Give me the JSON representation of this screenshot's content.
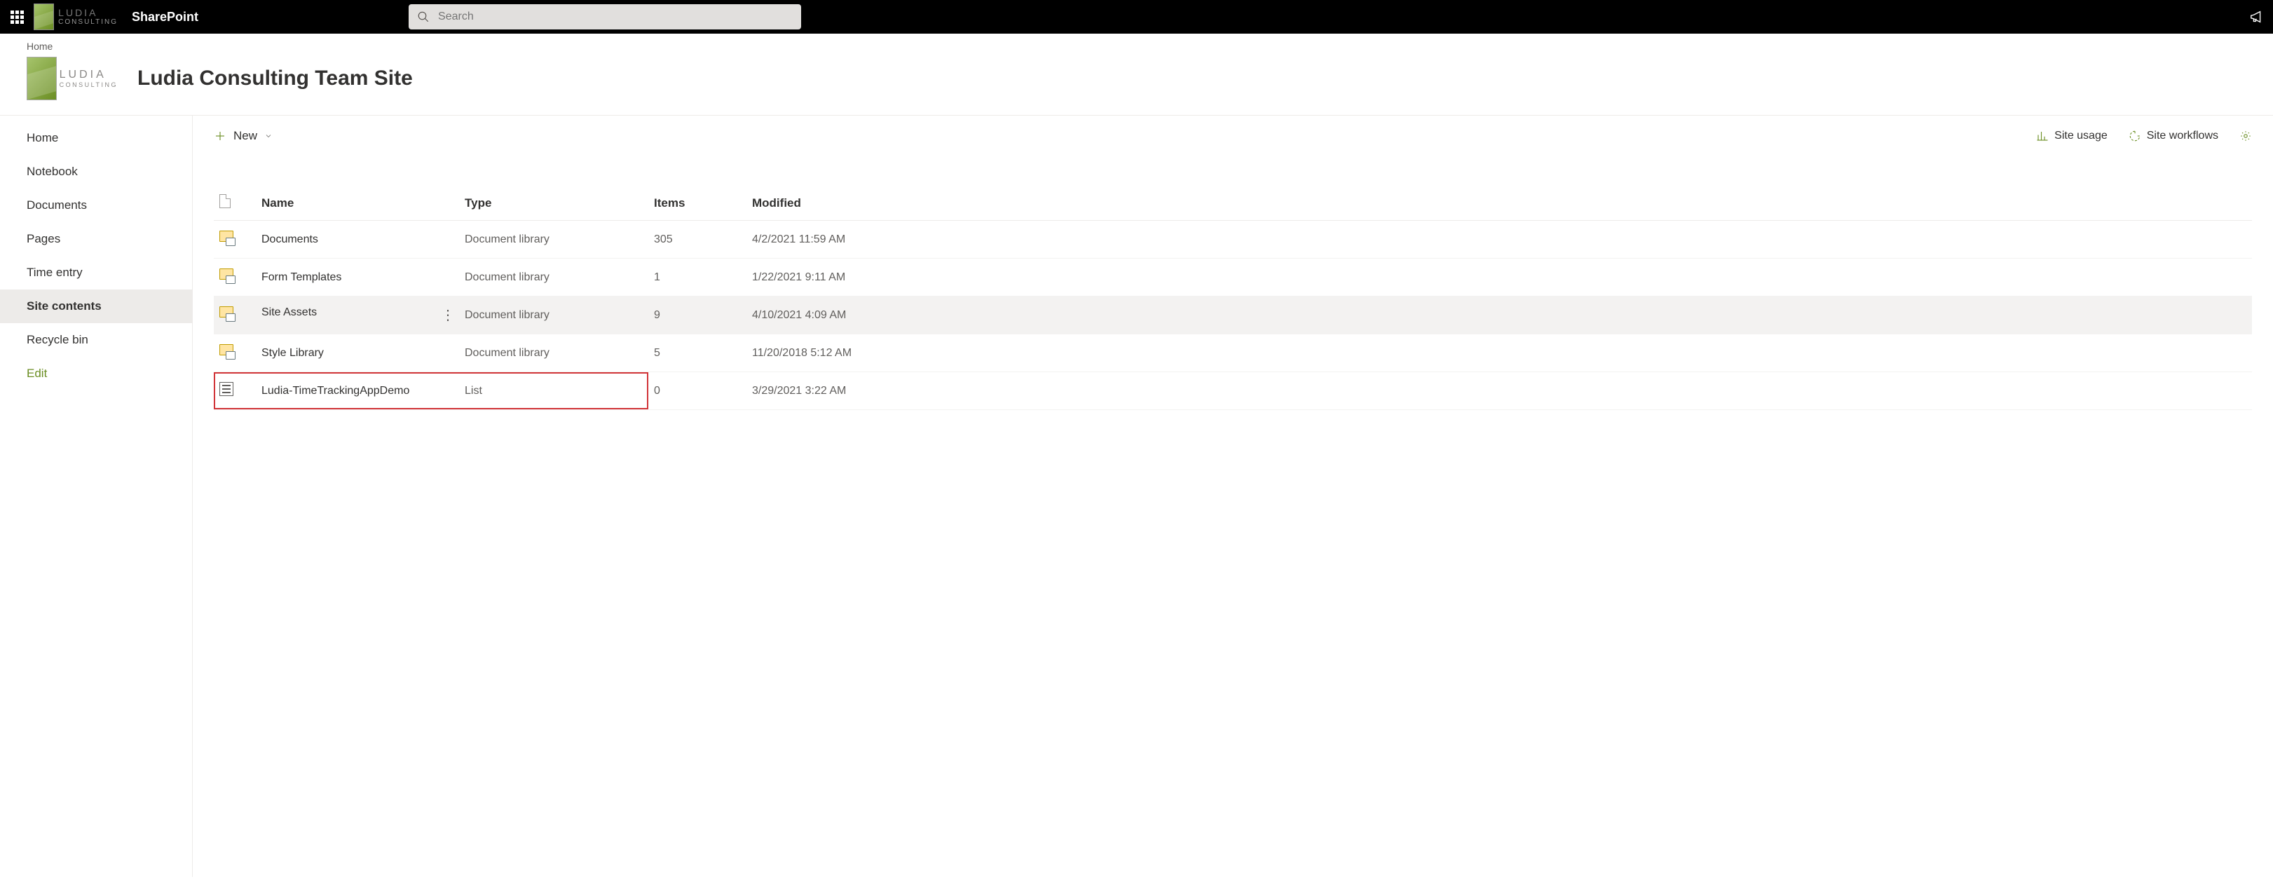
{
  "suite": {
    "app_name": "SharePoint",
    "search_placeholder": "Search",
    "tenant_name_top": "LUDIA",
    "tenant_name_bottom": "CONSULTING"
  },
  "breadcrumb": {
    "home": "Home"
  },
  "site": {
    "title": "Ludia Consulting Team Site",
    "logo_top": "LUDIA",
    "logo_bottom": "CONSULTING"
  },
  "leftnav": {
    "items": [
      {
        "label": "Home"
      },
      {
        "label": "Notebook"
      },
      {
        "label": "Documents"
      },
      {
        "label": "Pages"
      },
      {
        "label": "Time entry"
      },
      {
        "label": "Site contents",
        "active": true
      },
      {
        "label": "Recycle bin"
      }
    ],
    "edit_label": "Edit"
  },
  "commands": {
    "new_label": "New",
    "site_usage": "Site usage",
    "site_workflows": "Site workflows"
  },
  "table": {
    "headers": {
      "name": "Name",
      "type": "Type",
      "items": "Items",
      "modified": "Modified"
    },
    "rows": [
      {
        "icon": "doclib",
        "name": "Documents",
        "type": "Document library",
        "items": "305",
        "modified": "4/2/2021 11:59 AM"
      },
      {
        "icon": "doclib",
        "name": "Form Templates",
        "type": "Document library",
        "items": "1",
        "modified": "1/22/2021 9:11 AM"
      },
      {
        "icon": "doclib",
        "name": "Site Assets",
        "type": "Document library",
        "items": "9",
        "modified": "4/10/2021 4:09 AM",
        "hover": true
      },
      {
        "icon": "doclib",
        "name": "Style Library",
        "type": "Document library",
        "items": "5",
        "modified": "11/20/2018 5:12 AM"
      },
      {
        "icon": "list",
        "name": "Ludia-TimeTrackingAppDemo",
        "type": "List",
        "items": "0",
        "modified": "3/29/2021 3:22 AM",
        "highlight": true
      }
    ]
  }
}
